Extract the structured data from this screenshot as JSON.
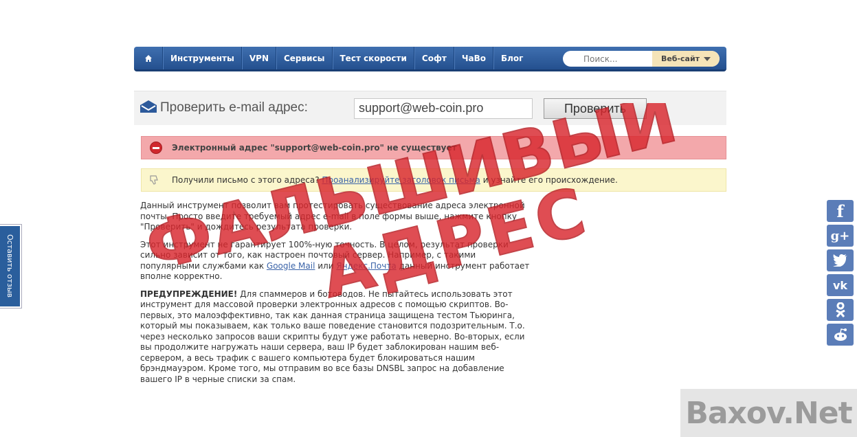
{
  "nav": {
    "items": [
      "Инструменты",
      "VPN",
      "Сервисы",
      "Тест скорости",
      "Софт",
      "ЧаВо",
      "Блог"
    ],
    "search_placeholder": "Поиск...",
    "search_scope": "Веб-сайт"
  },
  "check": {
    "label": "Проверить e-mail адрес:",
    "email_value": "support@web-coin.pro",
    "button": "Проверить"
  },
  "error": {
    "message": "Электронный адрес \"support@web-coin.pro\" не существует"
  },
  "notice": {
    "before": "Получили письмо с этого адреса?",
    "link": "Проанализируйте заголовок письма",
    "after": "и узнайте его происхождение."
  },
  "content": {
    "p1": "Данный инструмент позволит вам протестировать существование адреса электронной почты. Просто введите требуемый адрес e-mail в поле формы выше, нажмите кнопку \"Проверить\" и дождитесь результата проверки.",
    "p2_a": "Этот инструмент не гарантирует 100%-ную точность. В целом, результат проверки сильно зависит от того, как настроен почтовый сервер. Например, с такими популярными службами как",
    "p2_link1": "Google Mail",
    "p2_or": "или",
    "p2_link2": "Яндекс.Почта",
    "p2_b": "данный инструмент работает вполне корректно.",
    "p3_bold": "ПРЕДУПРЕЖДЕНИЕ!",
    "p3": "Для спаммеров и ботоводов. Не пытайтесь использовать этот инструмент для массовой проверки электронных адресов с помощью скриптов. Во-первых, это малоэффективно, так как данная страница защищена тестом Тьюринга, который мы показываем, как только ваше поведение становится подозрительным. Т.о. через несколько запросов ваши скрипты будут уже работать неверно. Во-вторых, если вы продолжите нагружать наши сервера, ваш IP будет заблокирован нашим веб-сервером, а весь трафик с вашего компьютера будет блокироваться нашим брэндмауэром. Кроме того, мы отправим во все базы DNSBL запрос на добавление вашего IP в черные списки за спам."
  },
  "stamp": {
    "line1": "ФАЛЬШИВЫЙ",
    "line2": "АДРЕС"
  },
  "feedback": {
    "label": "Оставить отзыв"
  },
  "social": {
    "icons": [
      "facebook-icon",
      "google-plus-icon",
      "twitter-icon",
      "vk-icon",
      "odnoklassniki-icon",
      "reddit-icon"
    ],
    "glyphs": [
      "f",
      "g+",
      "t",
      "vk",
      "ok",
      "r"
    ]
  },
  "watermark": {
    "text": "Baxov.Net"
  },
  "colors": {
    "nav": "#2d5a9b",
    "error_bg": "#f3a8ab",
    "notice_bg": "#fbf6cc",
    "stamp": "#d9272e",
    "social": "#5b7db8"
  }
}
